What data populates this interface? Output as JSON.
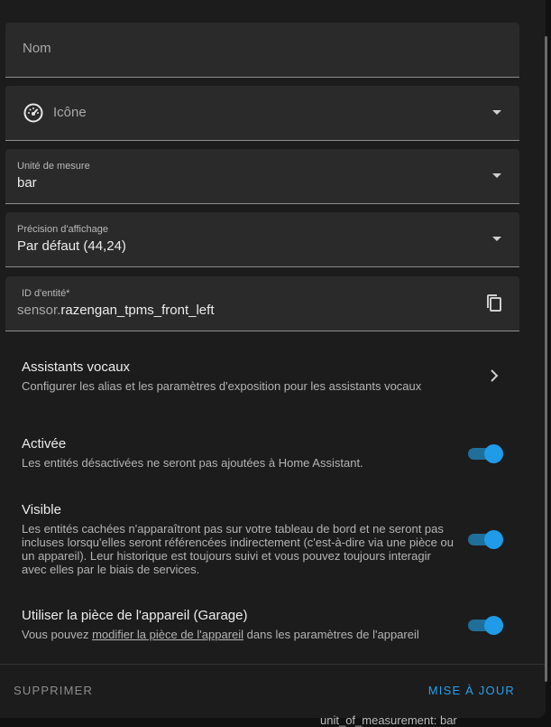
{
  "form": {
    "name_label": "Nom",
    "icon_label": "Icône",
    "unit_label": "Unité de mesure",
    "unit_value": "bar",
    "precision_label": "Précision d'affichage",
    "precision_value": "Par défaut (44,24)",
    "entity_id_label": "ID d'entité*",
    "entity_id_prefix": "sensor.",
    "entity_id_value": "razengan_tpms_front_left"
  },
  "voice": {
    "title": "Assistants vocaux",
    "desc": "Configurer les alias et les paramètres d'exposition pour les assistants vocaux"
  },
  "enabled": {
    "title": "Activée",
    "desc": "Les entités désactivées ne seront pas ajoutées à Home Assistant.",
    "on": true
  },
  "visible": {
    "title": "Visible",
    "desc": "Les entités cachées n'apparaîtront pas sur votre tableau de bord et ne seront pas incluses lorsqu'elles seront référencées indirectement (c'est-à-dire via une pièce ou un appareil). Leur historique est toujours suivi et vous pouvez toujours interagir avec elles par le biais de services.",
    "on": true
  },
  "area": {
    "title": "Utiliser la pièce de l'appareil (Garage)",
    "desc_before": "Vous pouvez ",
    "desc_link": "modifier la pièce de l'appareil",
    "desc_after": " dans les paramètres de l'appareil",
    "on": true
  },
  "actions": {
    "delete_label": "SUPPRIMER",
    "update_label": "MISE À JOUR"
  },
  "background": {
    "text": "unit_of_measurement: bar"
  },
  "colors": {
    "accent": "#1f9be8",
    "surface": "#2a2a2a",
    "dialog": "#1c1c1c"
  },
  "icons": {
    "icon_field": "gauge-icon",
    "entity_copy": "copy-icon",
    "voice_chevron": "chevron-right-icon"
  }
}
